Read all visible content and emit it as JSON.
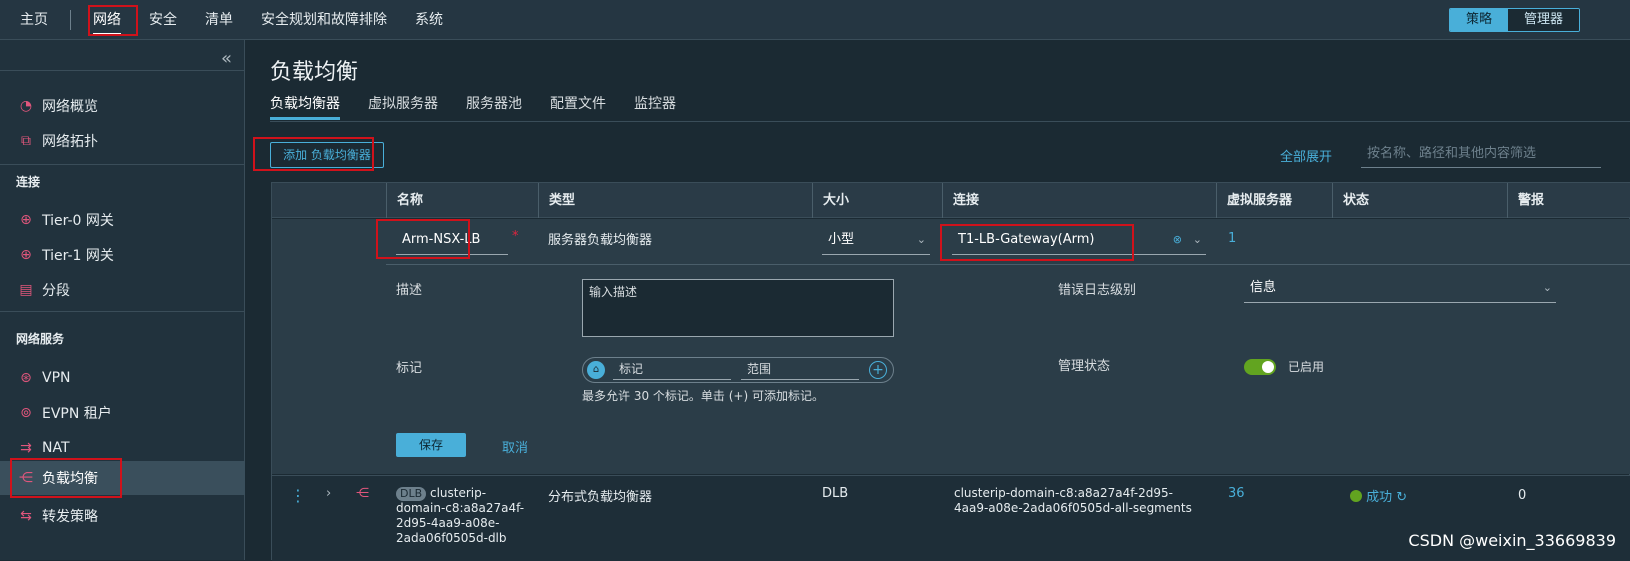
{
  "topnav": {
    "items": [
      "主页",
      "网络",
      "安全",
      "清单",
      "安全规划和故障排除",
      "系统"
    ],
    "active": "网络",
    "mode_toggle": {
      "policy": "策略",
      "manager": "管理器"
    }
  },
  "sidebar": {
    "collapse_icon": "«",
    "items": [
      {
        "label": "网络概览",
        "icon": "gauge-icon"
      },
      {
        "label": "网络拓扑",
        "icon": "topology-icon"
      }
    ],
    "section_connect": "连接",
    "connect_items": [
      {
        "label": "Tier-0 网关",
        "icon": "gateway-icon"
      },
      {
        "label": "Tier-1 网关",
        "icon": "gateway-icon"
      },
      {
        "label": "分段",
        "icon": "segment-icon"
      }
    ],
    "section_services": "网络服务",
    "service_items": [
      {
        "label": "VPN",
        "icon": "vpn-icon"
      },
      {
        "label": "EVPN 租户",
        "icon": "evpn-icon"
      },
      {
        "label": "NAT",
        "icon": "nat-icon"
      },
      {
        "label": "负载均衡",
        "icon": "load-balancer-icon",
        "active": true
      },
      {
        "label": "转发策略",
        "icon": "forwarding-icon"
      }
    ]
  },
  "main": {
    "title": "负载均衡",
    "tabs": [
      "负载均衡器",
      "虚拟服务器",
      "服务器池",
      "配置文件",
      "监控器"
    ],
    "add_button": "添加 负载均衡器",
    "expand_all": "全部展开",
    "filter_placeholder": "按名称、路径和其他内容筛选"
  },
  "grid": {
    "columns": [
      "名称",
      "类型",
      "大小",
      "连接",
      "虚拟服务器",
      "状态",
      "警报"
    ],
    "edit_row": {
      "name": "Arm-NSX-LB",
      "required_mark": "*",
      "type": "服务器负载均衡器",
      "size": "小型",
      "connection": "T1-LB-Gateway(Arm)",
      "virtual_servers": "1",
      "desc_label": "描述",
      "desc_placeholder": "输入描述",
      "error_log_label": "错误日志级别",
      "error_log_value": "信息",
      "tags_label": "标记",
      "tag_placeholder": "标记",
      "scope_placeholder": "范围",
      "tags_hint": "最多允许 30 个标记。单击 (+) 可添加标记。",
      "admin_state_label": "管理状态",
      "admin_state_value": "已启用",
      "save": "保存",
      "cancel": "取消"
    },
    "row": {
      "badge": "DLB",
      "name_lines": [
        "clusterip-",
        "domain-c8:a8a27a4f-",
        "2d95-4aa9-a08e-",
        "2ada06f0505d-dlb"
      ],
      "type": "分布式负载均衡器",
      "size": "DLB",
      "connection_lines": [
        "clusterip-domain-c8:a8a27a4f-2d95-",
        "4aa9-a08e-2ada06f0505d-all-segments"
      ],
      "virtual_servers": "36",
      "status": "成功",
      "alarms": "0"
    }
  },
  "watermark": "CSDN @weixin_33669839"
}
